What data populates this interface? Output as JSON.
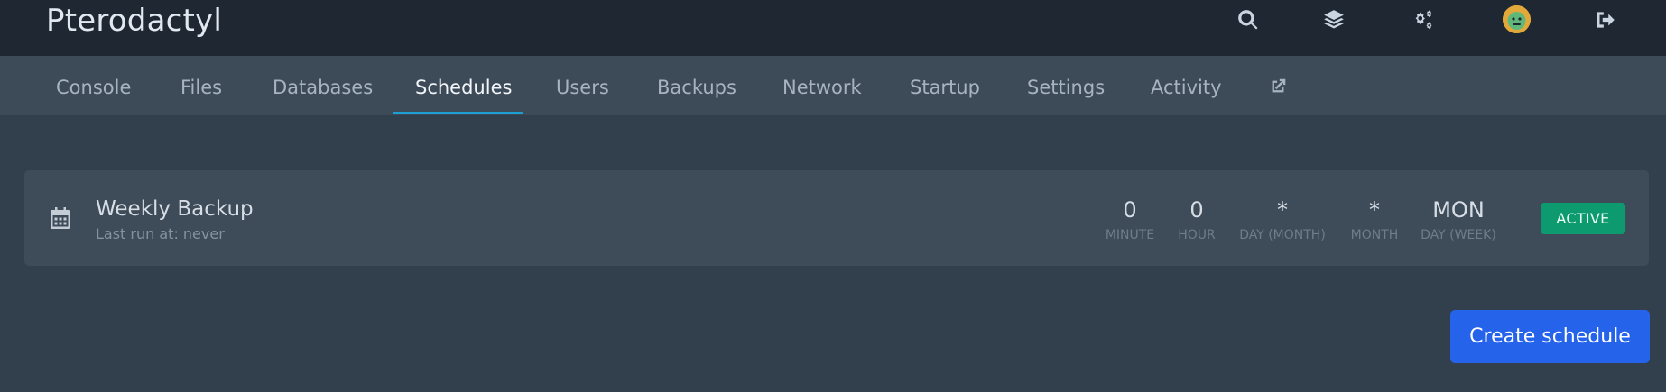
{
  "header": {
    "brand": "Pterodactyl",
    "icons": [
      "search-icon",
      "layers-icon",
      "cogs-icon",
      "avatar",
      "sign-out-icon"
    ]
  },
  "nav": {
    "tabs": [
      {
        "label": "Console"
      },
      {
        "label": "Files"
      },
      {
        "label": "Databases"
      },
      {
        "label": "Schedules",
        "active": true
      },
      {
        "label": "Users"
      },
      {
        "label": "Backups"
      },
      {
        "label": "Network"
      },
      {
        "label": "Startup"
      },
      {
        "label": "Settings"
      },
      {
        "label": "Activity"
      }
    ],
    "external_icon": "external-link-icon"
  },
  "schedule": {
    "name": "Weekly Backup",
    "last_run": "Last run at: never",
    "icon": "calendar-icon",
    "cron": [
      {
        "value": "0",
        "label": "MINUTE"
      },
      {
        "value": "0",
        "label": "HOUR"
      },
      {
        "value": "*",
        "label": "DAY (MONTH)"
      },
      {
        "value": "*",
        "label": "MONTH"
      },
      {
        "value": "MON",
        "label": "DAY (WEEK)"
      }
    ],
    "status": "ACTIVE"
  },
  "actions": {
    "create_label": "Create schedule"
  },
  "colors": {
    "header_bg": "#1f2732",
    "nav_bg": "#3d4b59",
    "page_bg": "#323f4d",
    "accent": "#1e9fd4",
    "status_active": "#0c9a6e",
    "primary_button": "#2563eb"
  }
}
